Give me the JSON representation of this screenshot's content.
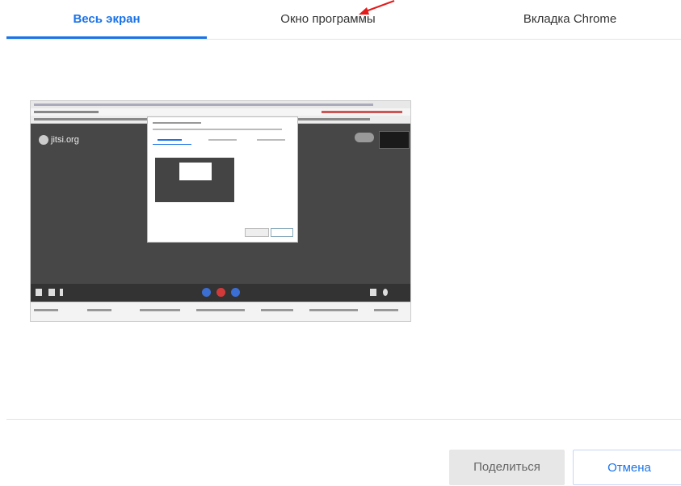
{
  "tabs": [
    {
      "label": "Весь экран",
      "active": true
    },
    {
      "label": "Окно программы",
      "active": false
    },
    {
      "label": "Вкладка Chrome",
      "active": false
    }
  ],
  "preview": {
    "site_logo_text": "jitsi.org"
  },
  "buttons": {
    "share_label": "Поделиться",
    "cancel_label": "Отмена"
  },
  "colors": {
    "accent": "#1a73e8",
    "annotation_arrow": "#e41b1b"
  },
  "icons": {
    "annotation": "red-arrow-icon"
  }
}
